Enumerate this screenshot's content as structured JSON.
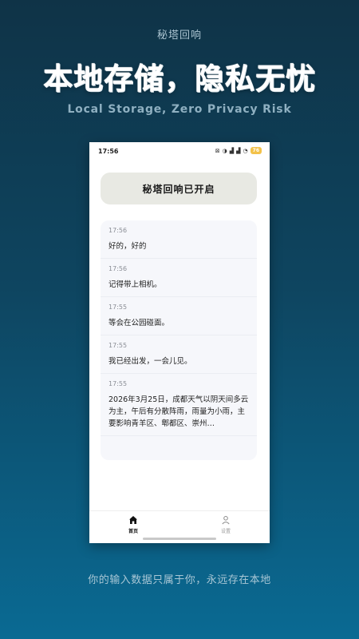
{
  "app_name": "秘塔回响",
  "headline": "本地存储，隐私无忧",
  "subhead": "Local Storage, Zero Privacy Risk",
  "footer": "你的输入数据只属于你，永远存在本地",
  "phone": {
    "status_time": "17:56",
    "battery": "76",
    "banner": "秘塔回响已开启",
    "messages": [
      {
        "time": "17:56",
        "text": "好的，好的"
      },
      {
        "time": "17:56",
        "text": "记得带上相机。"
      },
      {
        "time": "17:55",
        "text": "等会在公园碰面。"
      },
      {
        "time": "17:55",
        "text": "我已经出发，一会儿见。"
      },
      {
        "time": "17:55",
        "text": "2026年3月25日，成都天气以阴天间多云为主，午后有分散阵雨，雨量为小雨，主要影响青羊区、郫都区、崇州…"
      }
    ],
    "tabs": [
      {
        "label": "首页",
        "icon": "home-icon",
        "active": true
      },
      {
        "label": "设置",
        "icon": "user-icon",
        "active": false
      }
    ]
  }
}
